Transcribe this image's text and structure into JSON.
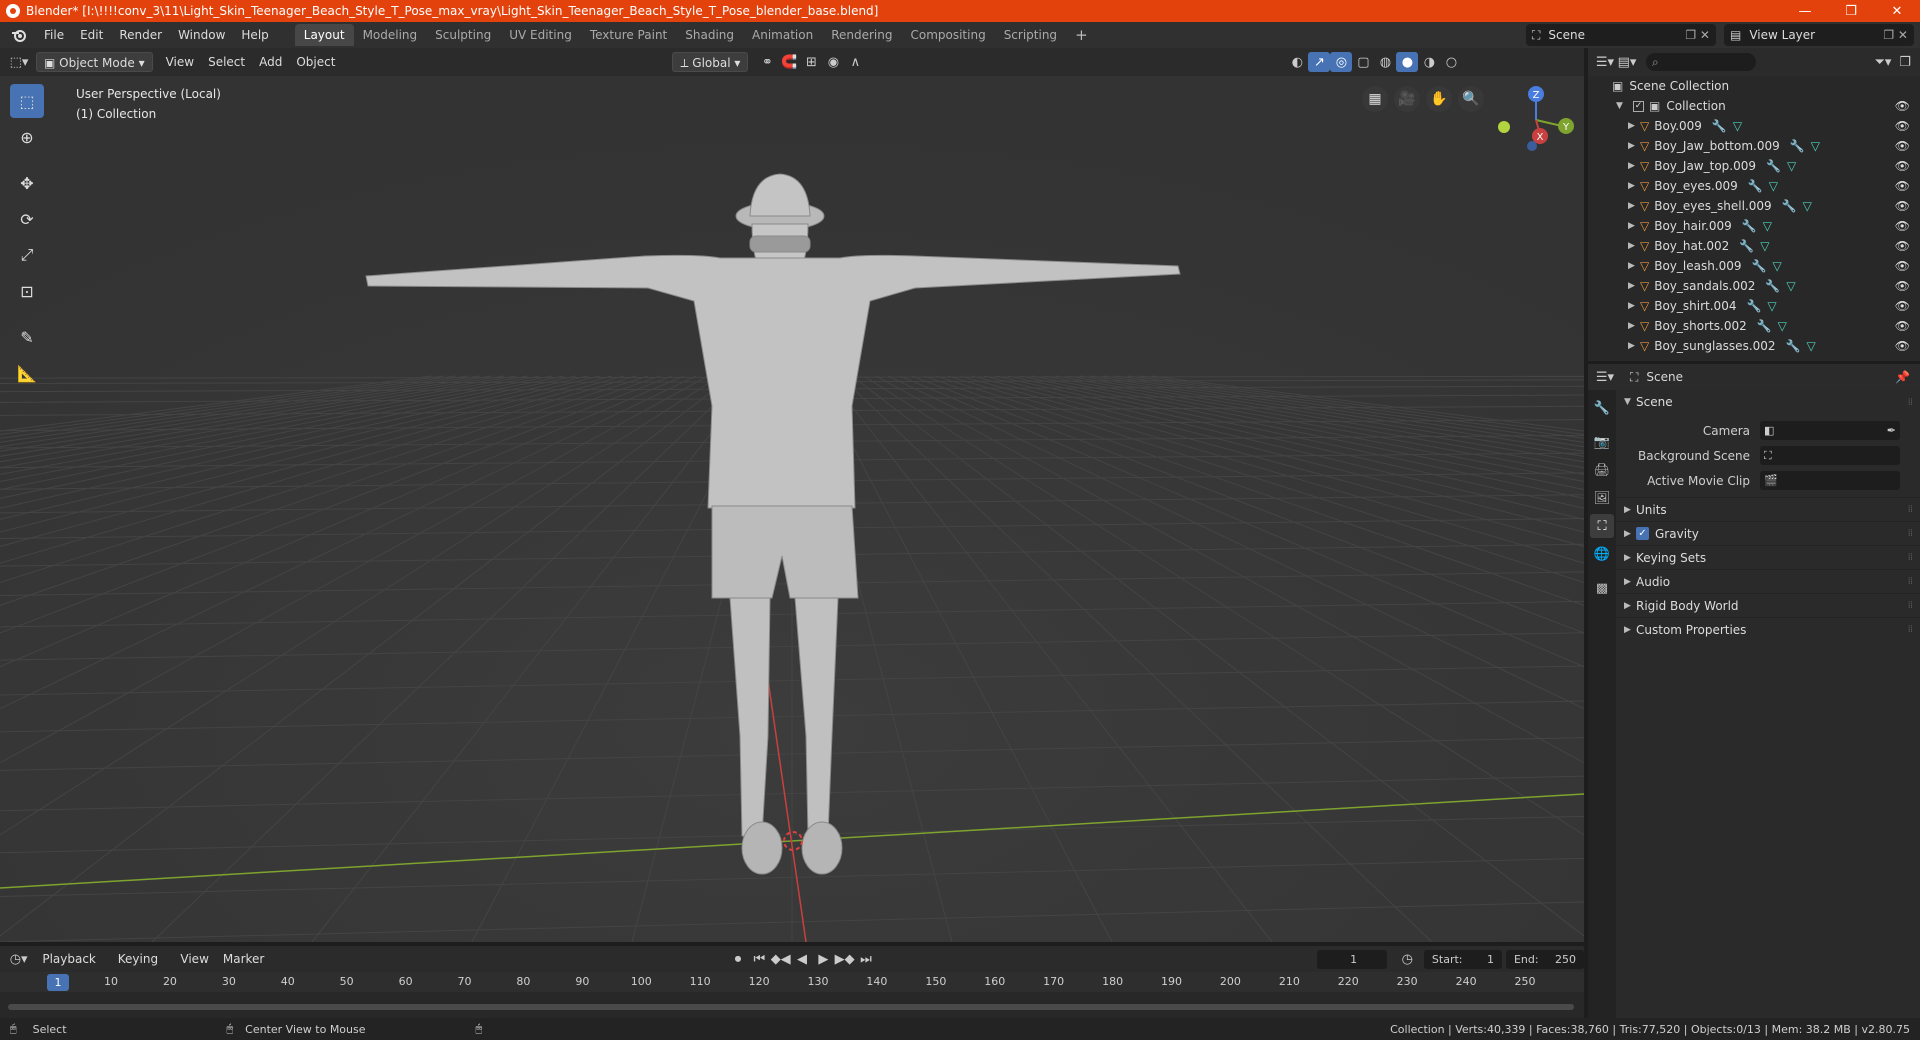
{
  "titlebar": {
    "title": "Blender* [I:\\!!!!conv_3\\11\\Light_Skin_Teenager_Beach_Style_T_Pose_max_vray\\Light_Skin_Teenager_Beach_Style_T_Pose_blender_base.blend]",
    "minimize": "—",
    "restore": "❐",
    "close": "✕"
  },
  "menu": [
    "File",
    "Edit",
    "Render",
    "Window",
    "Help"
  ],
  "workspaces": [
    "Layout",
    "Modeling",
    "Sculpting",
    "UV Editing",
    "Texture Paint",
    "Shading",
    "Animation",
    "Rendering",
    "Compositing",
    "Scripting"
  ],
  "workspace_add": "+",
  "scene_selector": {
    "value": "Scene"
  },
  "view_layer_selector": {
    "value": "View Layer"
  },
  "viewport_header": {
    "mode": "Object Mode",
    "menus": [
      "View",
      "Select",
      "Add",
      "Object"
    ],
    "transform_orientation": "Global"
  },
  "viewport": {
    "perspective_label": "User Perspective (Local)",
    "collection_label": "(1) Collection",
    "gizmo": {
      "z": "Z",
      "y": "Y",
      "x": "X"
    },
    "colors": {
      "bg": "#3a3a3a",
      "x_axis": "#c8403f",
      "y_axis": "#7ea32e",
      "active_tool": "#4772b3"
    }
  },
  "outliner": {
    "root": "Scene Collection",
    "collection": "Collection",
    "items": [
      "Boy.009",
      "Boy_Jaw_bottom.009",
      "Boy_Jaw_top.009",
      "Boy_eyes.009",
      "Boy_eyes_shell.009",
      "Boy_hair.009",
      "Boy_hat.002",
      "Boy_leash.009",
      "Boy_sandals.002",
      "Boy_shirt.004",
      "Boy_shorts.002",
      "Boy_sunglasses.002"
    ]
  },
  "properties": {
    "context": "Scene",
    "panel": "Scene",
    "fields": [
      {
        "label": "Camera",
        "value": ""
      },
      {
        "label": "Background Scene",
        "value": ""
      },
      {
        "label": "Active Movie Clip",
        "value": ""
      }
    ],
    "sub_panels": [
      "Units",
      "Gravity",
      "Keying Sets",
      "Audio",
      "Rigid Body World",
      "Custom Properties"
    ]
  },
  "timeline": {
    "menus": [
      "Playback",
      "Keying",
      "View",
      "Marker"
    ],
    "current_frame": "1",
    "start_label": "Start:",
    "start": "1",
    "end_label": "End:",
    "end": "250",
    "ticks": [
      "1",
      "10",
      "20",
      "30",
      "40",
      "50",
      "60",
      "70",
      "80",
      "90",
      "100",
      "110",
      "120",
      "130",
      "140",
      "150",
      "160",
      "170",
      "180",
      "190",
      "200",
      "210",
      "220",
      "230",
      "240",
      "250"
    ]
  },
  "statusbar": {
    "select": "Select",
    "center_view": "Center View to Mouse",
    "stats": "Collection | Verts:40,339 | Faces:38,760 | Tris:77,520 | Objects:0/13 | Mem: 38.2 MB | v2.80.75"
  }
}
